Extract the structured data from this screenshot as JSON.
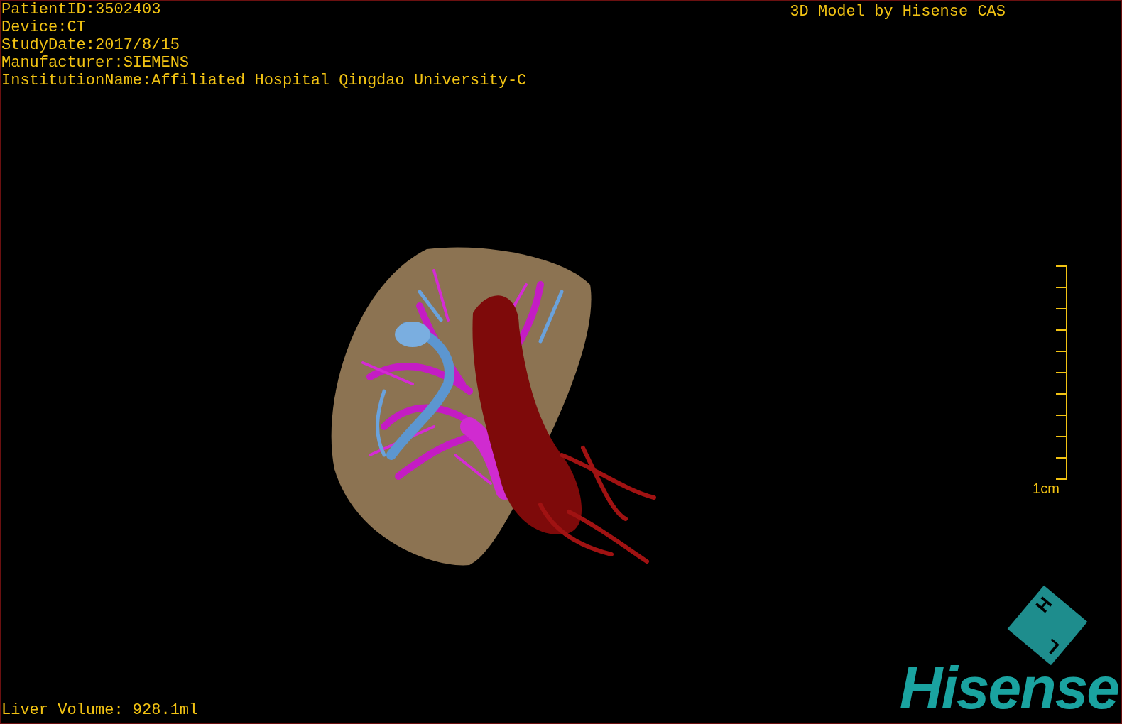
{
  "study_info": [
    "PatientID:3502403",
    "Device:CT",
    "StudyDate:2017/8/15",
    "Manufacturer:SIEMENS",
    "InstitutionName:Affiliated Hospital Qingdao University-C"
  ],
  "viewer_title": "3D Model by Hisense CAS",
  "scale_bar": {
    "label": "1cm"
  },
  "liver_volume": "Liver Volume: 928.1ml",
  "orientation_cube": {
    "labels": [
      "H",
      "L"
    ]
  },
  "logo": "Hisense"
}
